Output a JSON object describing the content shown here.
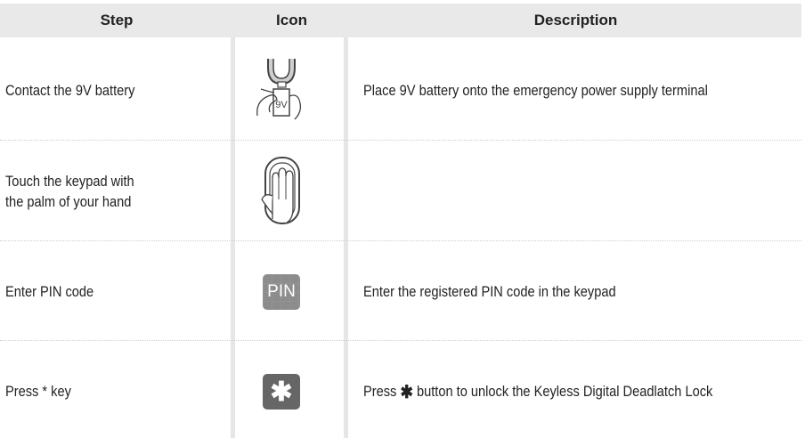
{
  "header": {
    "step": "Step",
    "icon": "Icon",
    "description": "Description"
  },
  "rows": [
    {
      "step": "Contact the 9V battery",
      "icon": "battery-hand-icon",
      "description": "Place 9V battery onto the emergency power supply terminal",
      "battery_text": "9V"
    },
    {
      "step_line1": "Touch the keypad with",
      "step_line2": "the palm of your hand",
      "icon": "palm-keypad-icon",
      "description": ""
    },
    {
      "step": "Enter PIN code",
      "icon": "pin-icon",
      "icon_text": "PIN",
      "description": "Enter the registered PIN code in the keypad"
    },
    {
      "step": "Press * key",
      "icon": "star-key-icon",
      "icon_text": "✱",
      "description_pre": "Press",
      "description_star": "✱",
      "description_post": "button to unlock the Keyless Digital Deadlatch Lock"
    }
  ],
  "colors": {
    "header_bg": "#e9e9e9",
    "separator": "#e6e6e6",
    "pin_bg": "#8c8c8c",
    "star_bg": "#666666"
  }
}
